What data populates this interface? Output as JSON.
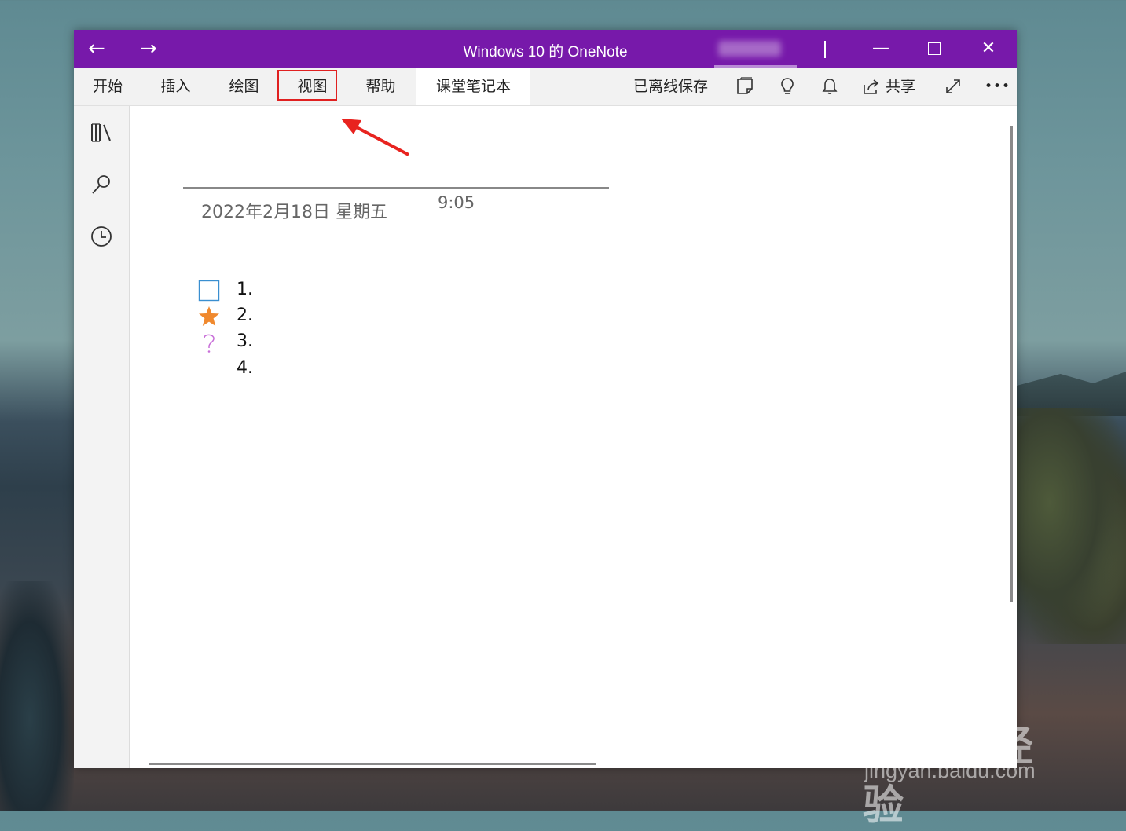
{
  "window": {
    "title": "Windows 10 的 OneNote",
    "nav_back": "←",
    "nav_forward": "→",
    "minimize": "—",
    "close": "✕"
  },
  "ribbon": {
    "tabs": [
      {
        "label": "开始"
      },
      {
        "label": "插入"
      },
      {
        "label": "绘图"
      },
      {
        "label": "视图"
      },
      {
        "label": "帮助"
      },
      {
        "label": "课堂笔记本"
      }
    ],
    "highlighted_tab": "视图",
    "sync_status": "已离线保存",
    "share_label": "共享",
    "more": "•••"
  },
  "page": {
    "date": "2022年2月18日 星期五",
    "time": "9:05",
    "list_items": [
      {
        "number": "1.",
        "tag": "checkbox-icon"
      },
      {
        "number": "2.",
        "tag": "star-icon"
      },
      {
        "number": "3.",
        "tag": "question-icon"
      },
      {
        "number": "4.",
        "tag": ""
      }
    ]
  },
  "watermark": {
    "main": "Baidu 经验",
    "sub": "jingyan.baidu.com"
  },
  "colors": {
    "titlebar": "#7719aa",
    "highlight": "#e02020",
    "star": "#f0892e",
    "question": "#c86fd8",
    "checkbox": "#3a8fd0"
  }
}
